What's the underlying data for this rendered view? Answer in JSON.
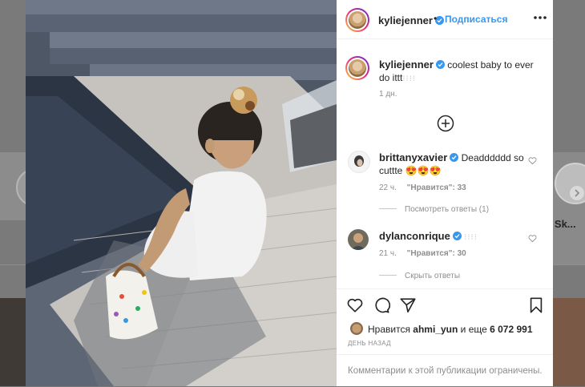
{
  "post": {
    "author": "kyliejenner",
    "follow_label": "Подписаться",
    "caption": "coolest baby to ever do ittt",
    "caption_time": "1 дн.",
    "load_more_icon": "plus-circle-icon"
  },
  "comments": [
    {
      "user": "brittanyxavier",
      "text": "Deadddddd so cuttte 😍😍😍",
      "time": "22 ч.",
      "likes": "\"Нравится\": 33",
      "replies_label": "Посмотреть ответы (1)"
    },
    {
      "user": "dylanconrique",
      "text": "",
      "time": "21 ч.",
      "likes": "\"Нравится\": 30",
      "replies_label": "Скрыть ответы"
    }
  ],
  "actions": {
    "icons": [
      "heart-icon",
      "comment-icon",
      "share-icon",
      "bookmark-icon"
    ]
  },
  "likes": {
    "prefix": "Нравится",
    "user": "ahmi_yun",
    "middle": "и еще",
    "count": "6 072 991"
  },
  "date_label": "ДЕНЬ НАЗАД",
  "comments_limited": "Комментарии к этой публикации ограничены.",
  "background": {
    "right_story_label": "er Sk..."
  },
  "colors": {
    "accent": "#3897f0",
    "verified": "#3897f0",
    "text": "#262626",
    "muted": "#8e8e8e"
  }
}
